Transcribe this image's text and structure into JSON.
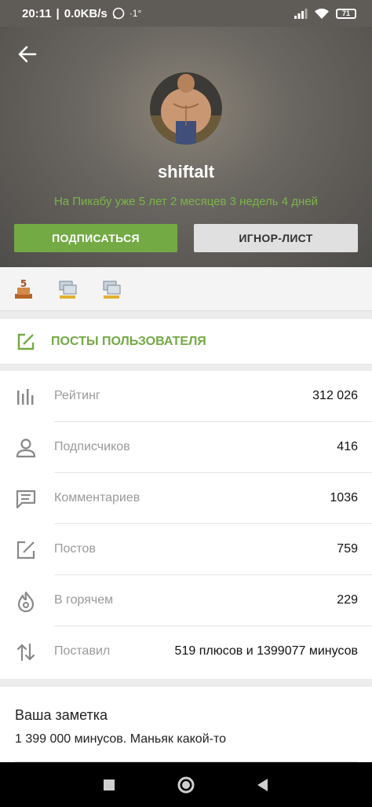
{
  "status_bar": {
    "time": "20:11",
    "speed": "0.0KB/s",
    "extra": "·1°",
    "battery": "71"
  },
  "profile": {
    "username": "shiftalt",
    "since": "На Пикабу уже 5 лет 2 месяцев 3 недель 4 дней",
    "subscribe_label": "ПОДПИСАТЬСЯ",
    "ignore_label": "ИГНОР-ЛИСТ"
  },
  "awards": [
    {
      "icon": "award-5-years-icon"
    },
    {
      "icon": "award-computer-icon"
    },
    {
      "icon": "award-computer-icon"
    }
  ],
  "posts_link": {
    "label": "ПОСТЫ ПОЛЬЗОВАТЕЛЯ",
    "icon": "edit-icon"
  },
  "stats": [
    {
      "icon": "rating-icon",
      "label": "Рейтинг",
      "value": "312 026"
    },
    {
      "icon": "person-icon",
      "label": "Подписчиков",
      "value": "416"
    },
    {
      "icon": "comment-icon",
      "label": "Комментариев",
      "value": "1036"
    },
    {
      "icon": "edit-icon",
      "label": "Постов",
      "value": "759"
    },
    {
      "icon": "fire-icon",
      "label": "В горячем",
      "value": "229"
    },
    {
      "icon": "swap-vert-icon",
      "label": "Поставил",
      "value": "519 плюсов и 1399077 минусов"
    }
  ],
  "note": {
    "title": "Ваша заметка",
    "text": "1 399 000 минусов. Маньяк какой-то"
  },
  "colors": {
    "accent": "#73aa44",
    "since_text": "#7ab648",
    "muted_label": "#9a9a9a"
  }
}
